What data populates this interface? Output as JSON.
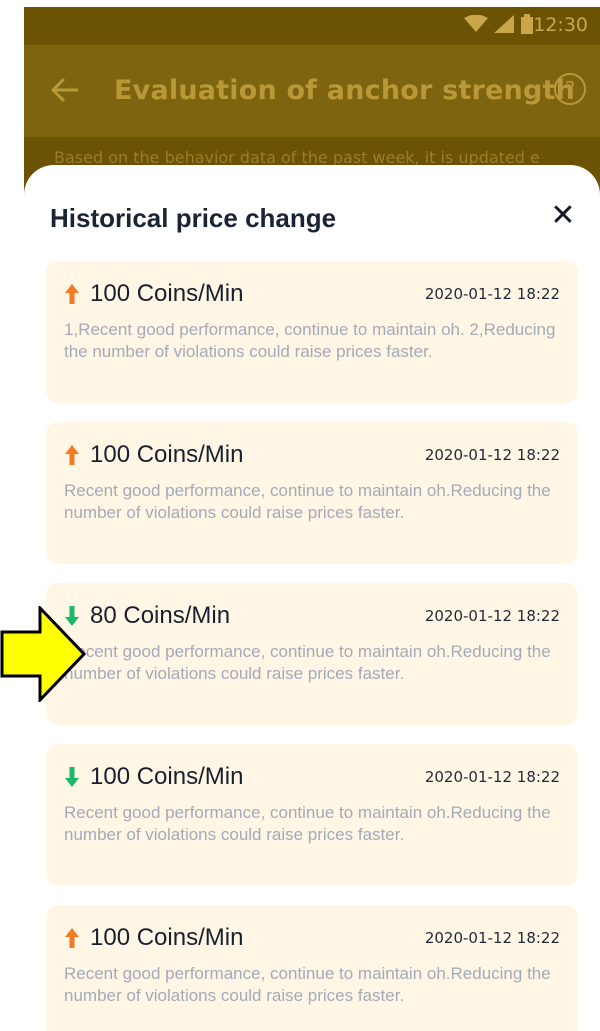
{
  "status_bar": {
    "time": "12:30"
  },
  "app_bar": {
    "title": "Evaluation of anchor strength",
    "help_glyph": "?"
  },
  "subnote": "Based on the behavior data of the past week, it is updated e",
  "sheet": {
    "title": "Historical price change",
    "close_glyph": "✕"
  },
  "colors": {
    "up": "#f47b21",
    "down": "#1bb86a",
    "card_bg": "#fff6e6",
    "pointer": "#ffff00"
  },
  "entries": [
    {
      "direction": "up",
      "price": "100 Coins/Min",
      "timestamp": "2020-01-12 18:22",
      "description": "1,Recent good performance, continue to maintain oh. 2,Reducing the number of violations could raise prices faster."
    },
    {
      "direction": "up",
      "price": "100 Coins/Min",
      "timestamp": "2020-01-12 18:22",
      "description": "Recent good performance, continue to maintain oh.Reducing the number of violations could raise prices faster."
    },
    {
      "direction": "down",
      "price": "80 Coins/Min",
      "timestamp": "2020-01-12 18:22",
      "description": "Recent good performance, continue to maintain oh.Reducing the number of violations could raise prices faster."
    },
    {
      "direction": "down",
      "price": "100 Coins/Min",
      "timestamp": "2020-01-12 18:22",
      "description": "Recent good performance, continue to maintain oh.Reducing the number of violations could raise prices faster."
    },
    {
      "direction": "up",
      "price": "100 Coins/Min",
      "timestamp": "2020-01-12 18:22",
      "description": "Recent good performance, continue to maintain oh.Reducing the number of violations could raise prices faster."
    }
  ]
}
